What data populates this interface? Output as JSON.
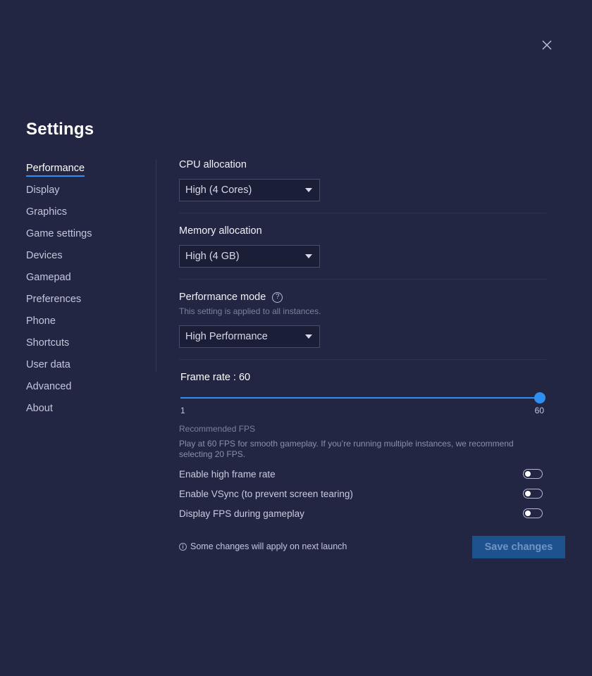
{
  "header": {
    "title": "Settings",
    "close_icon": "close-icon"
  },
  "sidebar": {
    "items": [
      {
        "label": "Performance",
        "active": true
      },
      {
        "label": "Display"
      },
      {
        "label": "Graphics"
      },
      {
        "label": "Game settings"
      },
      {
        "label": "Devices"
      },
      {
        "label": "Gamepad"
      },
      {
        "label": "Preferences"
      },
      {
        "label": "Phone"
      },
      {
        "label": "Shortcuts"
      },
      {
        "label": "User data"
      },
      {
        "label": "Advanced"
      },
      {
        "label": "About"
      }
    ]
  },
  "performance": {
    "cpu": {
      "label": "CPU allocation",
      "value": "High (4 Cores)"
    },
    "memory": {
      "label": "Memory allocation",
      "value": "High (4 GB)"
    },
    "mode": {
      "label": "Performance mode",
      "help_icon": "?",
      "subtitle": "This setting is applied to all instances.",
      "value": "High Performance"
    },
    "frame_rate": {
      "label": "Frame rate : 60",
      "value": 60,
      "min": 1,
      "max": 60,
      "min_label": "1",
      "max_label": "60"
    },
    "recommended": {
      "title": "Recommended FPS",
      "text": "Play at 60 FPS for smooth gameplay. If you’re running multiple instances, we recommend selecting 20 FPS."
    },
    "toggles": [
      {
        "label": "Enable high frame rate",
        "on": false
      },
      {
        "label": "Enable VSync (to prevent screen tearing)",
        "on": false
      },
      {
        "label": "Display FPS during gameplay",
        "on": false
      }
    ]
  },
  "footer": {
    "info_icon": "i",
    "note": "Some changes will apply on next launch",
    "save_label": "Save changes"
  },
  "colors": {
    "background": "#232642",
    "accent": "#2e8ff0",
    "save_button": "#1e528e"
  }
}
